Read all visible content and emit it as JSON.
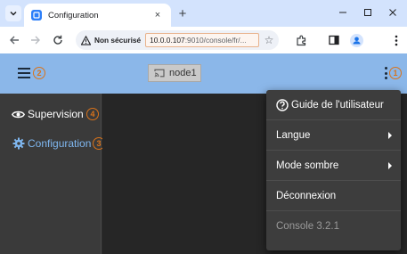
{
  "browser": {
    "tab_title": "Configuration",
    "tab_close": "×",
    "new_tab": "+",
    "security_label": "Non sécurisé",
    "url_host": "10.0.0.107",
    "url_rest": ":9010/console/fr/...",
    "star": "☆"
  },
  "header": {
    "node_label": "node1",
    "badges": {
      "menu": "1",
      "hamburger": "2",
      "configuration": "3",
      "supervision": "4"
    }
  },
  "sidebar": {
    "items": [
      {
        "label": "Supervision",
        "icon": "eye-icon",
        "active": false
      },
      {
        "label": "Configuration",
        "icon": "gear-icon",
        "active": true
      }
    ]
  },
  "menu": {
    "items": [
      {
        "label": "Guide de l'utilisateur",
        "icon": "help-circle-icon",
        "submenu": false,
        "disabled": false
      },
      {
        "label": "Langue",
        "submenu": true,
        "disabled": false
      },
      {
        "label": "Mode sombre",
        "submenu": true,
        "disabled": false
      },
      {
        "label": "Déconnexion",
        "submenu": false,
        "disabled": false
      },
      {
        "label": "Console 3.2.1",
        "submenu": false,
        "disabled": true
      }
    ]
  },
  "colors": {
    "header_bg": "#8bb7e9",
    "badge": "#d9731a",
    "active_link": "#7fb7f0",
    "menu_bg": "#3d3d3d"
  }
}
